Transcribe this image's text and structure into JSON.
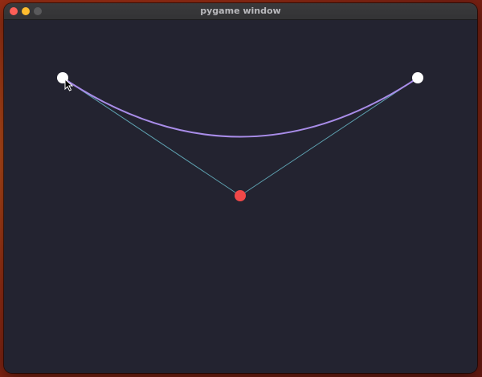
{
  "window": {
    "title": "pygame window"
  },
  "colors": {
    "close": "#fe5f57",
    "minimize": "#febc2e",
    "zoom": "#5a5a5c",
    "canvas_background": "#232330",
    "curve": "#a88ce8",
    "control_lines": "#5ea1b0",
    "endpoint": "#ffffff",
    "control_point": "#f04848"
  },
  "scene": {
    "description_type": "quadratic-bezier",
    "points": [
      "start-point",
      "end-point",
      "control-point"
    ],
    "cursor": "arrow-cursor-icon"
  }
}
